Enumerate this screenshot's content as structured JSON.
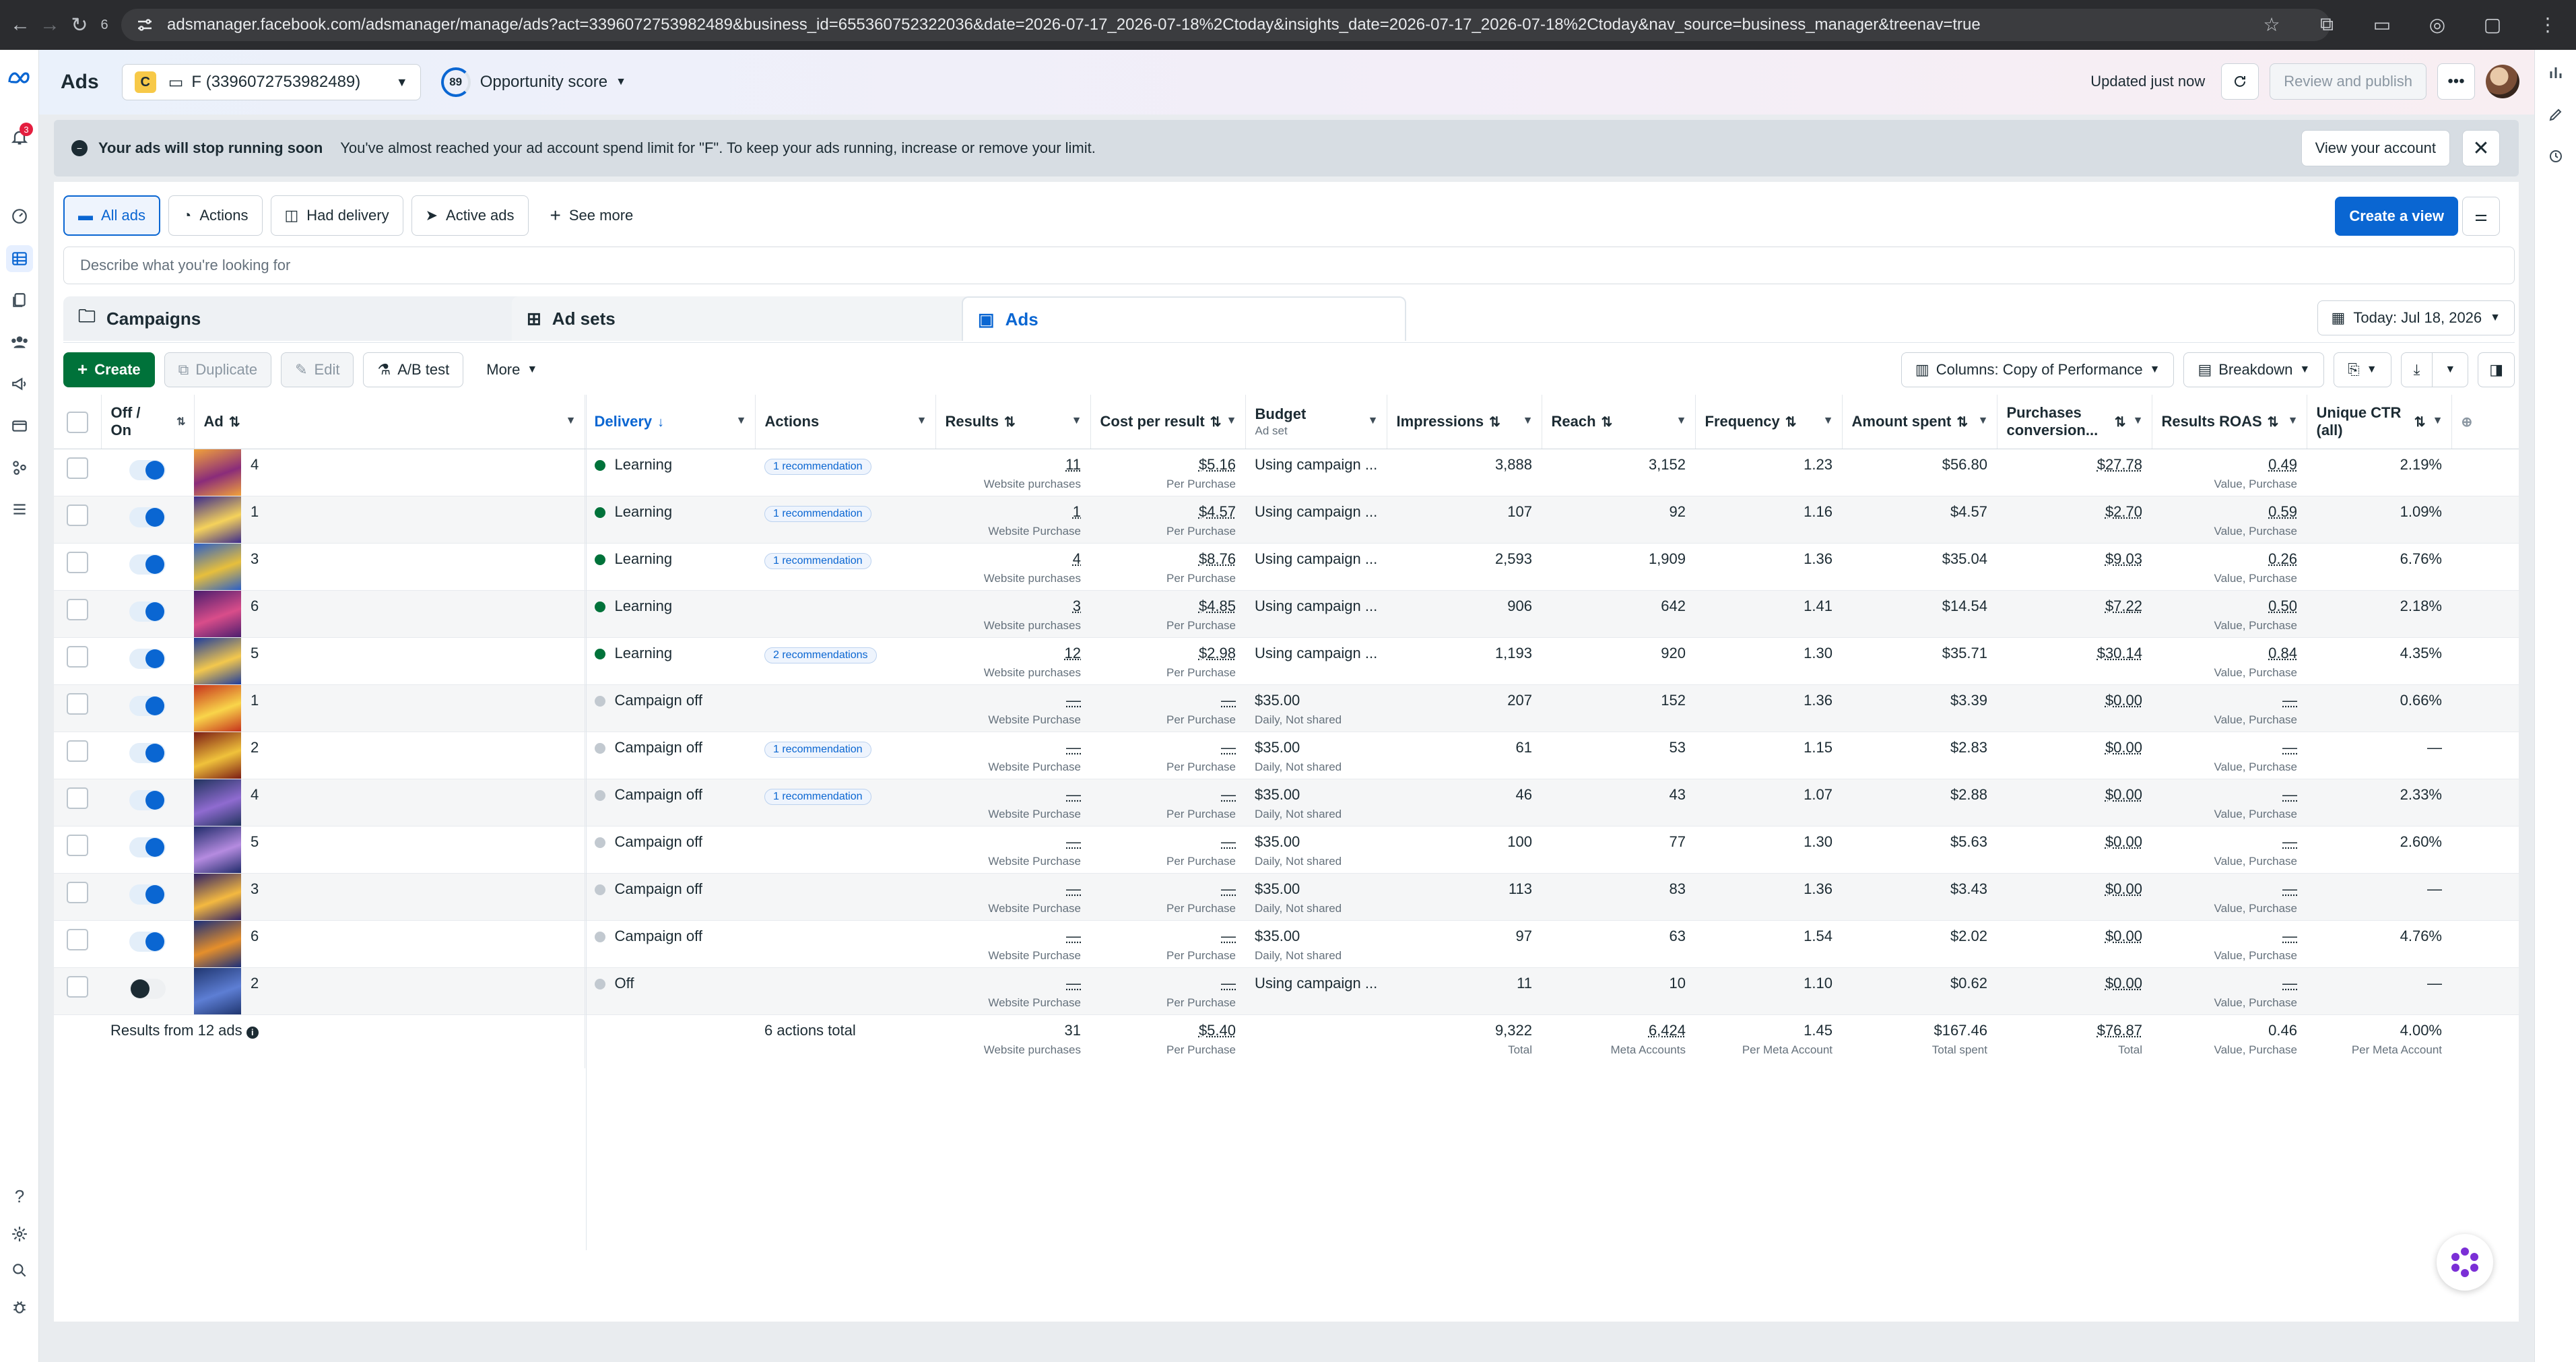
{
  "browser": {
    "tab_count": "6",
    "url": "adsmanager.facebook.com/adsmanager/manage/ads?act=3396072753982489&business_id=655360752322036&date=2026-07-17_2026-07-18%2Ctoday&insights_date=2026-07-17_2026-07-18%2Ctoday&nav_source=business_manager&treenav=true"
  },
  "left_rail": {
    "notification_count": "3"
  },
  "header": {
    "title": "Ads",
    "account_badge": "C",
    "account_name": "F (3396072753982489)",
    "opportunity_score_value": "89",
    "opportunity_score_label": "Opportunity score",
    "updated_text": "Updated just now",
    "review_publish_label": "Review and publish"
  },
  "banner": {
    "title": "Your ads will stop running soon",
    "message": "You've almost reached your ad account spend limit for \"F\". To keep your ads running, increase or remove your limit.",
    "action_label": "View your account"
  },
  "views": {
    "items": [
      {
        "label": "All ads"
      },
      {
        "label": "Actions"
      },
      {
        "label": "Had delivery"
      },
      {
        "label": "Active ads"
      },
      {
        "label": "See more"
      }
    ],
    "create_view_label": "Create a view"
  },
  "search": {
    "placeholder": "Describe what you're looking for"
  },
  "level_tabs": {
    "campaigns": "Campaigns",
    "adsets": "Ad sets",
    "ads": "Ads",
    "date_label": "Today: Jul 18, 2026"
  },
  "toolbar": {
    "create": "Create",
    "duplicate": "Duplicate",
    "edit": "Edit",
    "abtest": "A/B test",
    "more": "More",
    "columns": "Columns: Copy of Performance",
    "breakdown": "Breakdown"
  },
  "columns": {
    "offon_1": "Off /",
    "offon_2": "On",
    "ad": "Ad",
    "delivery": "Delivery",
    "actions": "Actions",
    "results": "Results",
    "cpr": "Cost per result",
    "budget": "Budget",
    "budget_sub": "Ad set",
    "impressions": "Impressions",
    "reach": "Reach",
    "frequency": "Frequency",
    "amount": "Amount spent",
    "pcv_1": "Purchases",
    "pcv_2": "conversion...",
    "roas": "Results ROAS",
    "ctr_1": "Unique CTR",
    "ctr_2": "(all)"
  },
  "rows": [
    {
      "name": "4",
      "delivery": "Learning",
      "rec": "1 recommendation",
      "results": "11",
      "results_sub": "Website purchases",
      "cpr": "$5.16",
      "cpr_sub": "Per Purchase",
      "budget": "Using campaign ...",
      "budget_sub": "",
      "impr": "3,888",
      "reach": "3,152",
      "freq": "1.23",
      "spent": "$56.80",
      "pcv": "$27.78",
      "roas": "0.49",
      "roas_sub": "Value, Purchase",
      "ctr": "2.19%"
    },
    {
      "name": "1",
      "delivery": "Learning",
      "rec": "1 recommendation",
      "results": "1",
      "results_sub": "Website Purchase",
      "cpr": "$4.57",
      "cpr_sub": "Per Purchase",
      "budget": "Using campaign ...",
      "budget_sub": "",
      "impr": "107",
      "reach": "92",
      "freq": "1.16",
      "spent": "$4.57",
      "pcv": "$2.70",
      "roas": "0.59",
      "roas_sub": "Value, Purchase",
      "ctr": "1.09%"
    },
    {
      "name": "3",
      "delivery": "Learning",
      "rec": "1 recommendation",
      "results": "4",
      "results_sub": "Website purchases",
      "cpr": "$8.76",
      "cpr_sub": "Per Purchase",
      "budget": "Using campaign ...",
      "budget_sub": "",
      "impr": "2,593",
      "reach": "1,909",
      "freq": "1.36",
      "spent": "$35.04",
      "pcv": "$9.03",
      "roas": "0.26",
      "roas_sub": "Value, Purchase",
      "ctr": "6.76%"
    },
    {
      "name": "6",
      "delivery": "Learning",
      "rec": "",
      "results": "3",
      "results_sub": "Website purchases",
      "cpr": "$4.85",
      "cpr_sub": "Per Purchase",
      "budget": "Using campaign ...",
      "budget_sub": "",
      "impr": "906",
      "reach": "642",
      "freq": "1.41",
      "spent": "$14.54",
      "pcv": "$7.22",
      "roas": "0.50",
      "roas_sub": "Value, Purchase",
      "ctr": "2.18%"
    },
    {
      "name": "5",
      "delivery": "Learning",
      "rec": "2 recommendations",
      "results": "12",
      "results_sub": "Website purchases",
      "cpr": "$2.98",
      "cpr_sub": "Per Purchase",
      "budget": "Using campaign ...",
      "budget_sub": "",
      "impr": "1,193",
      "reach": "920",
      "freq": "1.30",
      "spent": "$35.71",
      "pcv": "$30.14",
      "roas": "0.84",
      "roas_sub": "Value, Purchase",
      "ctr": "4.35%"
    },
    {
      "name": "1",
      "delivery": "Campaign off",
      "rec": "",
      "results": "—",
      "results_sub": "Website Purchase",
      "cpr": "—",
      "cpr_sub": "Per Purchase",
      "budget": "$35.00",
      "budget_sub": "Daily, Not shared",
      "impr": "207",
      "reach": "152",
      "freq": "1.36",
      "spent": "$3.39",
      "pcv": "$0.00",
      "roas": "—",
      "roas_sub": "Value, Purchase",
      "ctr": "0.66%"
    },
    {
      "name": "2",
      "delivery": "Campaign off",
      "rec": "1 recommendation",
      "results": "—",
      "results_sub": "Website Purchase",
      "cpr": "—",
      "cpr_sub": "Per Purchase",
      "budget": "$35.00",
      "budget_sub": "Daily, Not shared",
      "impr": "61",
      "reach": "53",
      "freq": "1.15",
      "spent": "$2.83",
      "pcv": "$0.00",
      "roas": "—",
      "roas_sub": "Value, Purchase",
      "ctr": "—"
    },
    {
      "name": "4",
      "delivery": "Campaign off",
      "rec": "1 recommendation",
      "results": "—",
      "results_sub": "Website Purchase",
      "cpr": "—",
      "cpr_sub": "Per Purchase",
      "budget": "$35.00",
      "budget_sub": "Daily, Not shared",
      "impr": "46",
      "reach": "43",
      "freq": "1.07",
      "spent": "$2.88",
      "pcv": "$0.00",
      "roas": "—",
      "roas_sub": "Value, Purchase",
      "ctr": "2.33%"
    },
    {
      "name": "5",
      "delivery": "Campaign off",
      "rec": "",
      "results": "—",
      "results_sub": "Website Purchase",
      "cpr": "—",
      "cpr_sub": "Per Purchase",
      "budget": "$35.00",
      "budget_sub": "Daily, Not shared",
      "impr": "100",
      "reach": "77",
      "freq": "1.30",
      "spent": "$5.63",
      "pcv": "$0.00",
      "roas": "—",
      "roas_sub": "Value, Purchase",
      "ctr": "2.60%"
    },
    {
      "name": "3",
      "delivery": "Campaign off",
      "rec": "",
      "results": "—",
      "results_sub": "Website Purchase",
      "cpr": "—",
      "cpr_sub": "Per Purchase",
      "budget": "$35.00",
      "budget_sub": "Daily, Not shared",
      "impr": "113",
      "reach": "83",
      "freq": "1.36",
      "spent": "$3.43",
      "pcv": "$0.00",
      "roas": "—",
      "roas_sub": "Value, Purchase",
      "ctr": "—"
    },
    {
      "name": "6",
      "delivery": "Campaign off",
      "rec": "",
      "results": "—",
      "results_sub": "Website Purchase",
      "cpr": "—",
      "cpr_sub": "Per Purchase",
      "budget": "$35.00",
      "budget_sub": "Daily, Not shared",
      "impr": "97",
      "reach": "63",
      "freq": "1.54",
      "spent": "$2.02",
      "pcv": "$0.00",
      "roas": "—",
      "roas_sub": "Value, Purchase",
      "ctr": "4.76%"
    },
    {
      "name": "2",
      "delivery": "Off",
      "rec": "",
      "results": "—",
      "results_sub": "Website Purchase",
      "cpr": "—",
      "cpr_sub": "Per Purchase",
      "budget": "Using campaign ...",
      "budget_sub": "",
      "impr": "11",
      "reach": "10",
      "freq": "1.10",
      "spent": "$0.62",
      "pcv": "$0.00",
      "roas": "—",
      "roas_sub": "Value, Purchase",
      "ctr": "—"
    }
  ],
  "row_states": [
    "on",
    "on",
    "on",
    "on",
    "on",
    "on",
    "on",
    "on",
    "on",
    "on",
    "on",
    "off"
  ],
  "delivery_colors": {
    "Learning": "#00723a",
    "Campaign off": "#c2c9d0",
    "Off": "#c2c9d0"
  },
  "totals": {
    "label": "Results from 12 ads",
    "actions": "6 actions total",
    "results": "31",
    "results_sub": "Website purchases",
    "cpr": "$5.40",
    "cpr_sub": "Per Purchase",
    "impr": "9,322",
    "impr_sub": "Total",
    "reach": "6,424",
    "reach_sub": "Meta Accounts",
    "freq": "1.45",
    "freq_sub": "Per Meta Account",
    "spent": "$167.46",
    "spent_sub": "Total spent",
    "pcv": "$76.87",
    "pcv_sub": "Total",
    "roas": "0.46",
    "roas_sub": "Value, Purchase",
    "ctr": "4.00%",
    "ctr_sub": "Per Meta Account"
  },
  "colors": {
    "accent": "#0a66d2",
    "create_green": "#00723a"
  }
}
